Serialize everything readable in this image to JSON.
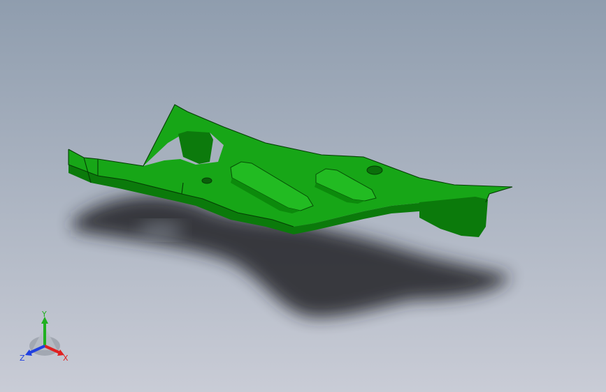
{
  "viewport": {
    "background_top_color": "#8f9dae",
    "background_bottom_color": "#c9ccd6",
    "part_color": "#17a617",
    "part_shade_color": "#0b7a0b",
    "shadow_color": "#202226"
  },
  "triad": {
    "x_label": "X",
    "y_label": "Y",
    "z_label": "Z",
    "x_color": "#e02020",
    "y_color": "#20b020",
    "z_color": "#2040e0"
  }
}
